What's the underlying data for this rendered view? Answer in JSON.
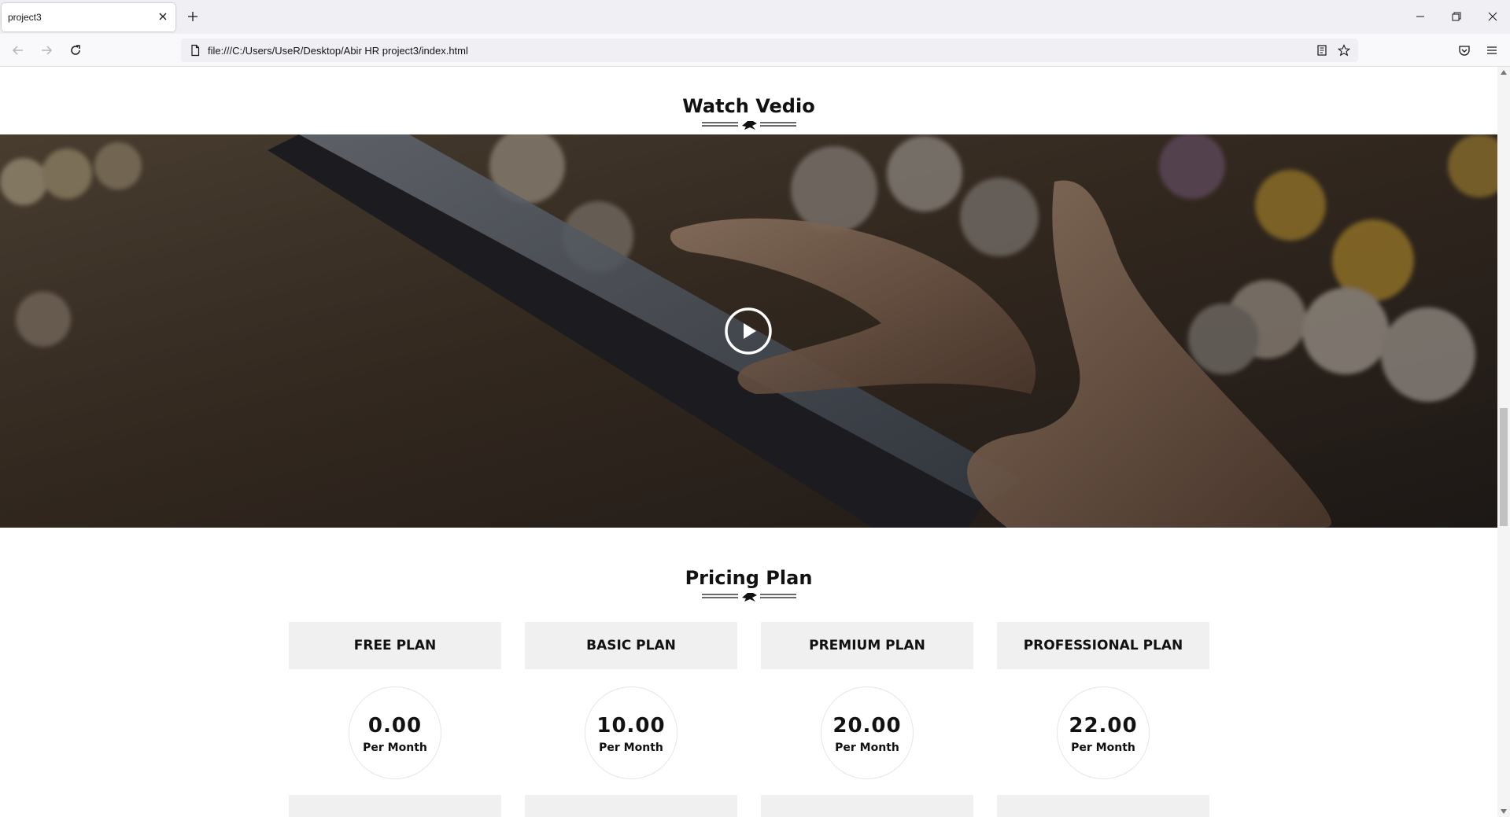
{
  "browser": {
    "tab_title": "project3",
    "url": "file:///C:/Users/UseR/Desktop/Abir HR project3/index.html"
  },
  "icons": {
    "tab_close": "close-icon",
    "new_tab": "plus-icon",
    "minimize": "minimize-icon",
    "restore": "restore-icon",
    "close_window": "close-icon",
    "back": "arrow-left-icon",
    "forward": "arrow-right-icon",
    "reload": "reload-icon",
    "page": "page-icon",
    "reader": "reader-view-icon",
    "bookmark": "star-icon",
    "pocket": "pocket-icon",
    "menu": "hamburger-menu-icon",
    "play": "play-circle-icon"
  },
  "video_section": {
    "title": "Watch Vedio"
  },
  "pricing_section": {
    "title": "Pricing Plan",
    "plans": [
      {
        "name": "FREE PLAN",
        "price": "0.00",
        "period": "Per Month"
      },
      {
        "name": "BASIC PLAN",
        "price": "10.00",
        "period": "Per Month"
      },
      {
        "name": "PREMIUM PLAN",
        "price": "20.00",
        "period": "Per Month"
      },
      {
        "name": "PROFESSIONAL PLAN",
        "price": "22.00",
        "period": "Per Month"
      }
    ]
  },
  "colors": {
    "plan_header_bg": "#f0f0f0",
    "text": "#111111",
    "chrome_bg": "#f0f0f4"
  }
}
